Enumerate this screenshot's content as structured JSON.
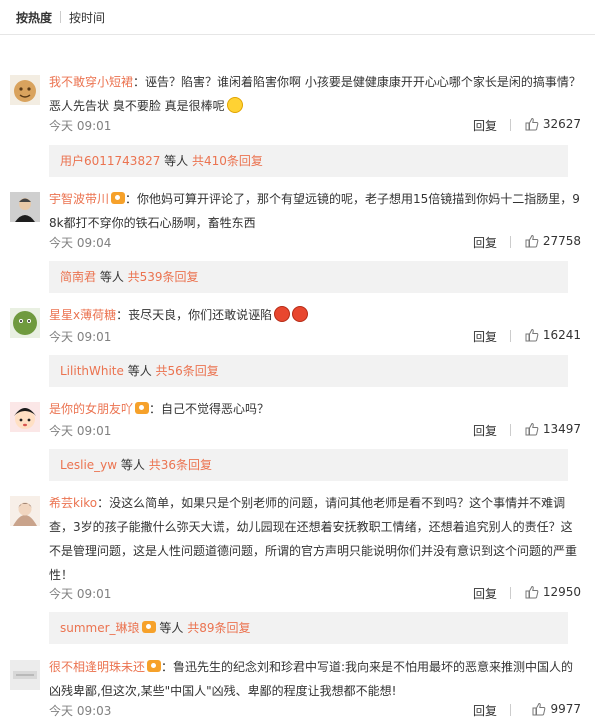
{
  "sort": {
    "hot": "按热度",
    "time": "按时间"
  },
  "comments": [
    {
      "user": "我不敢穿小短裙",
      "text": "：诬告？陷害？谁闲着陷害你啊 小孩要是健健康康开开心心哪个家长是闲的搞事情？ 恶人先告状 臭不要脸 真是很棒呢",
      "time": "今天 09:01",
      "reply": "回复",
      "likes": "32627",
      "sub_user": "用户6011743827",
      "sub_mid": " 等人 ",
      "sub_count": "共410条回复"
    },
    {
      "user": "宇智波带川",
      "text": "：你他妈可算开评论了，那个有望远镜的呢，老子想用15倍镜描到你妈十二指肠里，98k都打不穿你的铁石心肠啊，畜牲东西",
      "time": "今天 09:04",
      "reply": "回复",
      "likes": "27758",
      "sub_user": "简南君",
      "sub_mid": " 等人 ",
      "sub_count": "共539条回复"
    },
    {
      "user": "星星x薄荷糖",
      "text": "：丧尽天良，你们还敢说诬陷",
      "time": "今天 09:01",
      "reply": "回复",
      "likes": "16241",
      "sub_user": "LilithWhite",
      "sub_mid": " 等人 ",
      "sub_count": "共56条回复"
    },
    {
      "user": "是你的女朋友吖",
      "text": "：自己不觉得恶心吗？",
      "time": "今天 09:01",
      "reply": "回复",
      "likes": "13497",
      "sub_user": "Leslie_yw",
      "sub_mid": " 等人 ",
      "sub_count": "共36条回复"
    },
    {
      "user": "希芸kiko",
      "text": "：没这么简单，如果只是个别老师的问题，请问其他老师是看不到吗？这个事情并不难调查，3岁的孩子能撒什么弥天大谎，幼儿园现在还想着安抚教职工情绪，还想着追究别人的责任？这不是管理问题，这是人性问题道德问题，所谓的官方声明只能说明你们并没有意识到这个问题的严重性！",
      "time": "今天 09:01",
      "reply": "回复",
      "likes": "12950",
      "sub_user": "summer_琳琅",
      "sub_mid": " 等人 ",
      "sub_count": "共89条回复"
    },
    {
      "user": "很不相逢明珠未还",
      "text": "：鲁迅先生的纪念刘和珍君中写道:我向来是不怕用最坏的恶意来推测中国人的凶残卑鄙,但这次,某些\"中国人\"凶残、卑鄙的程度让我想都不能想!",
      "time": "今天 09:03",
      "reply": "回复",
      "likes": "9977"
    }
  ],
  "colors": {
    "username": "#eb7350",
    "text": "#333333",
    "meta": "#808080",
    "subbg": "#f2f2f2"
  }
}
